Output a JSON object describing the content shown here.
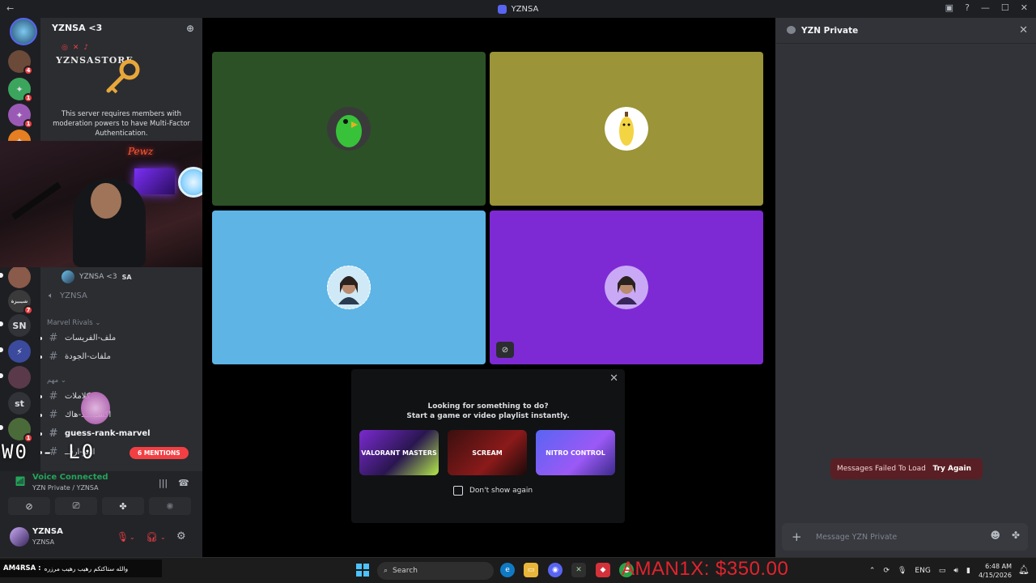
{
  "window": {
    "title": "YZNSA"
  },
  "server": {
    "name": "YZNSA <3",
    "banner_brand": "YZNSASTORE",
    "mfa_notice": "This server requires members with moderation powers to have Multi-Factor Authentication."
  },
  "rail": {
    "servers": [
      {
        "icon": "avatar-server",
        "badge": ""
      },
      {
        "icon": "avatar-server",
        "badge": "4"
      },
      {
        "icon": "game-server",
        "badge": "1",
        "color": "#3ba55d"
      },
      {
        "icon": "game-server",
        "badge": "1",
        "color": "#9b59b6"
      },
      {
        "icon": "game-server",
        "badge": "",
        "color": "#e67e22"
      },
      {
        "icon": "avatar-server",
        "badge": ""
      },
      {
        "icon": "avatar-server",
        "badge": "7"
      },
      {
        "label": "SN",
        "badge": ""
      },
      {
        "icon": "avatar-server",
        "badge": ""
      },
      {
        "icon": "avatar-server",
        "badge": ""
      },
      {
        "label": "st",
        "badge": ""
      },
      {
        "icon": "avatar-server",
        "badge": "1"
      }
    ]
  },
  "sidebar": {
    "voice_user": {
      "name": "YZNSA <3",
      "tag": "SA"
    },
    "voice_channel": "YZNSA",
    "category_1": "Marvel Rivals",
    "channels_1": [
      "ملف-الفريسات",
      "ملفات-الجودة"
    ],
    "category_2": "مهم",
    "channels_2": [
      "كلاملات",
      "اكسـ...ـد-هاك",
      "guess-rank-marvel",
      "اوتو-ارقــ"
    ],
    "mentions_label": "MENTIONS",
    "mentions_count": "6",
    "overlay_sign": "W0 - L0"
  },
  "voice_panel": {
    "status": "Voice Connected",
    "channel": "YZN Private / YZNSA"
  },
  "user_panel": {
    "name": "YZNSA",
    "sub": "YZNSA"
  },
  "webcam": {
    "neon_sign": "Pewz"
  },
  "stage": {
    "tiles": [
      {
        "color": "#2c5127",
        "avatar": "parrot"
      },
      {
        "color": "#9b9438",
        "avatar": "banana"
      },
      {
        "color": "#5db4e5",
        "avatar": "user"
      },
      {
        "color": "#7e2ad4",
        "avatar": "user",
        "muted": true
      }
    ],
    "activity": {
      "line1": "Looking for something to do?",
      "line2": "Start a game or video playlist instantly.",
      "cards": [
        "VALORANT MASTERS",
        "SCREAM",
        "NITRO CONTROL"
      ],
      "checkbox_label": "Don't show again"
    }
  },
  "chat": {
    "title": "YZN Private",
    "error_text": "Messages Failed To Load",
    "retry_label": "Try Again",
    "placeholder": "Message YZN Private"
  },
  "taskbar": {
    "ticker_name": "AM4RSA :",
    "ticker_text": "والله ستاكتكم رهيب رهيب مرزره",
    "search_placeholder": "Search",
    "donation": "AMAN1X: $350.00",
    "language": "ENG",
    "time": "6:48 AM",
    "date": "4/15/2026"
  }
}
